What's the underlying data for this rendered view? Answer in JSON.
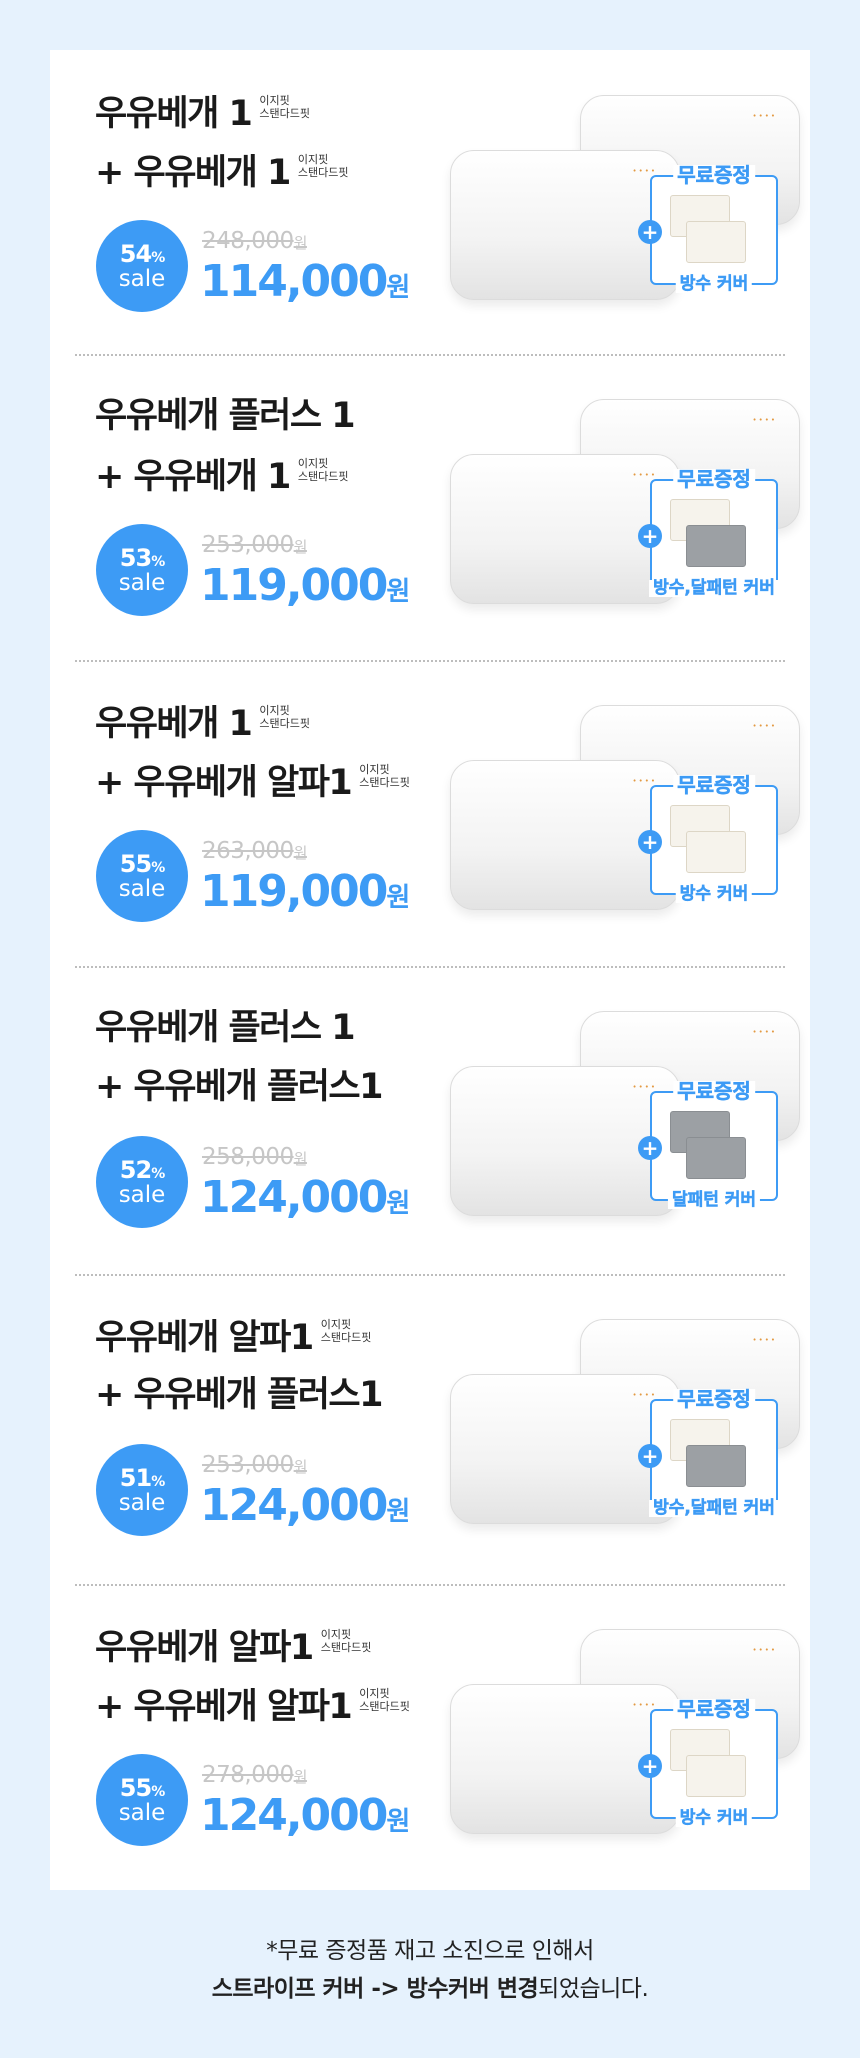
{
  "colors": {
    "accent": "#3d9bf5",
    "background": "#e6f2fd",
    "card": "#ffffff",
    "strike": "#c6c6c6"
  },
  "sub_label": [
    "이지핏",
    "스탠다드핏"
  ],
  "sections": [
    {
      "line1": "우유베개 1",
      "line1_sub": true,
      "line2": "+ 우유베개 1",
      "line2_sub": true,
      "discount": "54",
      "sale": "sale",
      "original": "248,000",
      "price": "114,000",
      "gift_top": "무료증정",
      "gift_bottom": "방수 커버",
      "gift_pack": "light"
    },
    {
      "line1": "우유베개 플러스 1",
      "line1_sub": false,
      "line2": "+ 우유베개 1",
      "line2_sub": true,
      "discount": "53",
      "sale": "sale",
      "original": "253,000",
      "price": "119,000",
      "gift_top": "무료증정",
      "gift_bottom": "방수,달패턴 커버",
      "gift_pack": "mixed"
    },
    {
      "line1": "우유베개 1",
      "line1_sub": true,
      "line2": "+ 우유베개 알파1",
      "line2_sub": true,
      "discount": "55",
      "sale": "sale",
      "original": "263,000",
      "price": "119,000",
      "gift_top": "무료증정",
      "gift_bottom": "방수 커버",
      "gift_pack": "light"
    },
    {
      "line1": "우유베개 플러스 1",
      "line1_sub": false,
      "line2": "+ 우유베개 플러스1",
      "line2_sub": false,
      "discount": "52",
      "sale": "sale",
      "original": "258,000",
      "price": "124,000",
      "gift_top": "무료증정",
      "gift_bottom": "달패턴 커버",
      "gift_pack": "dark"
    },
    {
      "line1": "우유베개 알파1",
      "line1_sub": true,
      "line2": "+ 우유베개 플러스1",
      "line2_sub": false,
      "discount": "51",
      "sale": "sale",
      "original": "253,000",
      "price": "124,000",
      "gift_top": "무료증정",
      "gift_bottom": "방수,달패턴 커버",
      "gift_pack": "mixed"
    },
    {
      "line1": "우유베개 알파1",
      "line1_sub": true,
      "line2": "+  우유베개 알파1",
      "line2_sub": true,
      "discount": "55",
      "sale": "sale",
      "original": "278,000",
      "price": "124,000",
      "gift_top": "무료증정",
      "gift_bottom": "방수 커버",
      "gift_pack": "light"
    }
  ],
  "units": {
    "percent": "%",
    "won": "원"
  },
  "note": {
    "line1": "*무료 증정품 재고 소진으로 인해서",
    "line2_bold1": "스트라이프 커버 -> 방수커버 변경",
    "line2_rest": "되었습니다."
  }
}
